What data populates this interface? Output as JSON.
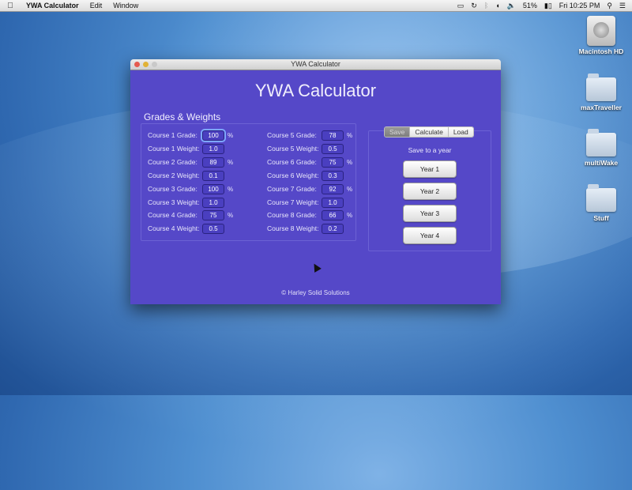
{
  "menubar": {
    "app_name": "YWA Calculator",
    "menus": [
      "Edit",
      "Window"
    ],
    "battery": "51%",
    "clock": "Fri 10:25 PM"
  },
  "desktop": {
    "icons": [
      {
        "label": "Macintosh HD",
        "icon": "hard-drive-icon"
      },
      {
        "label": "maxTraveller",
        "icon": "folder-icon"
      },
      {
        "label": "multiWake",
        "icon": "folder-icon"
      },
      {
        "label": "Stuff",
        "icon": "folder-icon"
      }
    ]
  },
  "window": {
    "title": "YWA Calculator",
    "app_title": "YWA Calculator",
    "group_title": "Grades & Weights",
    "courses_left": [
      {
        "grade_label": "Course 1 Grade:",
        "grade": "100",
        "weight_label": "Course 1 Weight:",
        "weight": "1.0"
      },
      {
        "grade_label": "Course 2 Grade:",
        "grade": "89",
        "weight_label": "Course 2 Weight:",
        "weight": "0.1"
      },
      {
        "grade_label": "Course 3 Grade:",
        "grade": "100",
        "weight_label": "Course 3 Weight:",
        "weight": "1.0"
      },
      {
        "grade_label": "Course 4 Grade:",
        "grade": "75",
        "weight_label": "Course 4 Weight:",
        "weight": "0.5"
      }
    ],
    "courses_right": [
      {
        "grade_label": "Course 5 Grade:",
        "grade": "78",
        "weight_label": "Course 5 Weight:",
        "weight": "0.5"
      },
      {
        "grade_label": "Course 6 Grade:",
        "grade": "75",
        "weight_label": "Course 6 Weight:",
        "weight": "0.3"
      },
      {
        "grade_label": "Course 7 Grade:",
        "grade": "92",
        "weight_label": "Course 7 Weight:",
        "weight": "1.0"
      },
      {
        "grade_label": "Course 8 Grade:",
        "grade": "66",
        "weight_label": "Course 8 Weight:",
        "weight": "0.2"
      }
    ],
    "percent_symbol": "%",
    "tabs": [
      "Save",
      "Calculate",
      "Load"
    ],
    "selected_tab": "Save",
    "save_label": "Save to a year",
    "year_buttons": [
      "Year 1",
      "Year 2",
      "Year 3",
      "Year 4"
    ],
    "footer": "© Harley Solid Solutions"
  }
}
